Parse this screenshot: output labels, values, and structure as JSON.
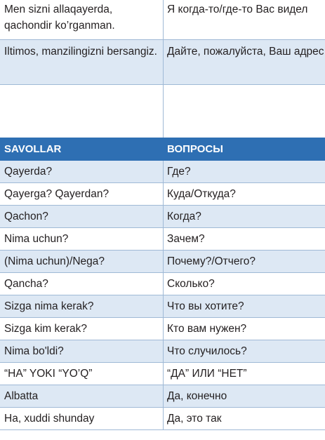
{
  "phrases": [
    {
      "uz": "Men sizni allaqayerda, qachondir ko’rganman.",
      "ru": "Я когда-то/где-то Вас видел"
    },
    {
      "uz": "Iltimos, manzilingizni bersangiz.",
      "ru": "Дайте, пожалуйста, Ваш адрес"
    }
  ],
  "questions": {
    "header_uz": "SAVOLLAR",
    "header_ru": "ВОПРОСЫ",
    "rows": [
      {
        "uz": "Qayerda?",
        "ru": "Где?"
      },
      {
        "uz": "Qayerga? Qayerdan?",
        "ru": "Куда/Откуда?"
      },
      {
        "uz": "Qachon?",
        "ru": "Когда?"
      },
      {
        "uz": "Nima uchun?",
        "ru": "Зачем?"
      },
      {
        "uz": "(Nima uchun)/Nega?",
        "ru": "Почему?/Отчего?"
      },
      {
        "uz": "Qancha?",
        "ru": "Сколько?"
      },
      {
        "uz": "Sizga nima kerak?",
        "ru": "Что вы хотите?"
      },
      {
        "uz": "Sizga kim kerak?",
        "ru": "Кто вам нужен?"
      },
      {
        "uz": "Nima bo'ldi?",
        "ru": "Что случилось?"
      },
      {
        "uz": "“HA” YOKI “YO’Q”",
        "ru": "“ДА” ИЛИ “НЕТ”"
      },
      {
        "uz": "Albatta",
        "ru": "Да, конечно"
      },
      {
        "uz": "Ha, xuddi shunday",
        "ru": "Да, это так"
      }
    ]
  }
}
